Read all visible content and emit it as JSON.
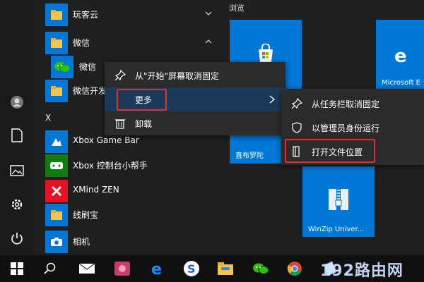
{
  "colors": {
    "accent": "#0078d7",
    "highlight_border": "#e0302a",
    "menu_bg": "#2b2b2b",
    "taskbar_bg": "#101010"
  },
  "applist": {
    "items": [
      {
        "label": "玩客云",
        "icon": "folder-icon"
      },
      {
        "label": "微信",
        "icon": "folder-icon"
      },
      {
        "label": "微信",
        "icon": "wechat-icon"
      },
      {
        "label": "微信开发",
        "icon": "folder-icon"
      },
      {
        "label": "Xbox Game Bar",
        "icon": "xbox-game-bar-icon"
      },
      {
        "label": "Xbox 控制台小帮手",
        "icon": "xbox-console-icon"
      },
      {
        "label": "XMind ZEN",
        "icon": "xmind-icon"
      },
      {
        "label": "线刷宝",
        "icon": "folder-icon"
      },
      {
        "label": "相机",
        "icon": "camera-icon"
      }
    ],
    "section_letter": "X"
  },
  "tiles": {
    "header": "浏览",
    "items": [
      {
        "label": "",
        "icon": "store-icon"
      },
      {
        "label": "Microsoft E",
        "icon": "edge-icon"
      },
      {
        "label": "直布罗陀",
        "icon": "weather-icon"
      },
      {
        "label": "WinZip Univer...",
        "icon": "winzip-icon"
      }
    ]
  },
  "context_menu": {
    "items": [
      {
        "label": "从\"开始\"屏幕取消固定",
        "icon": "unpin-icon"
      },
      {
        "label": "更多",
        "icon": ""
      },
      {
        "label": "卸载",
        "icon": "trash-icon"
      }
    ]
  },
  "submenu": {
    "items": [
      {
        "label": "从任务栏取消固定",
        "icon": "unpin-icon"
      },
      {
        "label": "以管理员身份运行",
        "icon": "admin-shield-icon"
      },
      {
        "label": "打开文件位置",
        "icon": "file-location-icon"
      }
    ]
  },
  "taskbar": {
    "icons": [
      "windows-start-icon",
      "search-icon",
      "mail-icon",
      "photos-icon",
      "edge-icon",
      "sogou-icon",
      "file-explorer-icon",
      "wechat-icon",
      "chrome-icon",
      "notepad-icon"
    ]
  },
  "watermark": "192路由网"
}
